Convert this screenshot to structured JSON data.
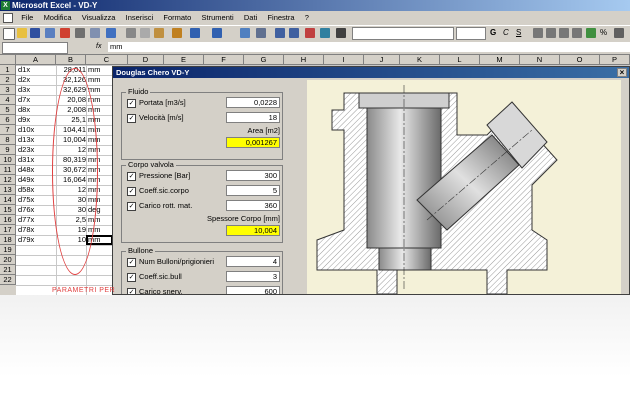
{
  "app": {
    "title": "Microsoft Excel - VD-Y",
    "icon": "excel-icon"
  },
  "menu": [
    "File",
    "Modifica",
    "Visualizza",
    "Inserisci",
    "Formato",
    "Strumenti",
    "Dati",
    "Finestra",
    "?"
  ],
  "formula_bar": {
    "name_box": "",
    "fx": "fx",
    "value": "mm"
  },
  "columns": [
    "A",
    "B",
    "C",
    "D",
    "E",
    "F",
    "G",
    "H",
    "I",
    "J",
    "K",
    "L",
    "M",
    "N",
    "O",
    "P"
  ],
  "rows": [
    "1",
    "2",
    "3",
    "4",
    "5",
    "6",
    "7",
    "8",
    "9",
    "10",
    "11",
    "12",
    "13",
    "14",
    "15",
    "16",
    "17",
    "18",
    "19",
    "20",
    "21",
    "22"
  ],
  "cells": [
    {
      "a": "d1x",
      "b": "28,011",
      "c": "mm"
    },
    {
      "a": "d2x",
      "b": "32,126",
      "c": "mm"
    },
    {
      "a": "d3x",
      "b": "32,629",
      "c": "mm"
    },
    {
      "a": "d7x",
      "b": "20,08",
      "c": "mm"
    },
    {
      "a": "d8x",
      "b": "2,008",
      "c": "mm"
    },
    {
      "a": "d9x",
      "b": "25,1",
      "c": "mm"
    },
    {
      "a": "d10x",
      "b": "104,41",
      "c": "mm"
    },
    {
      "a": "d13x",
      "b": "10,004",
      "c": "mm"
    },
    {
      "a": "d23x",
      "b": "12",
      "c": "mm"
    },
    {
      "a": "d31x",
      "b": "80,319",
      "c": "mm"
    },
    {
      "a": "d48x",
      "b": "30,672",
      "c": "mm"
    },
    {
      "a": "d49x",
      "b": "16,064",
      "c": "mm"
    },
    {
      "a": "d58x",
      "b": "12",
      "c": "mm"
    },
    {
      "a": "d75x",
      "b": "30",
      "c": "mm"
    },
    {
      "a": "d76x",
      "b": "30",
      "c": "deg"
    },
    {
      "a": "d77x",
      "b": "2,5",
      "c": "mm"
    },
    {
      "a": "d78x",
      "b": "19",
      "c": "mm"
    },
    {
      "a": "d79x",
      "b": "10",
      "c": "mm"
    }
  ],
  "annotation": "PARAMETRI PER",
  "dialog": {
    "title": "Douglas Chero VD-Y",
    "close": "×",
    "fluido": {
      "caption": "Fluido",
      "portata_label": "Portata [m3/s]",
      "portata_value": "0,0228",
      "velocita_label": "Velocità [m/s]",
      "velocita_value": "18",
      "area_label": "Area [m2]",
      "area_value": "0,001267"
    },
    "corpo": {
      "caption": "Corpo valvola",
      "pressione_label": "Pressione [Bar]",
      "pressione_value": "300",
      "coeff_label": "Coeff.sic.corpo",
      "coeff_value": "5",
      "carico_label": "Carico rott. mat.",
      "carico_value": "360",
      "spessore_label": "Spessore Corpo [mm]",
      "spessore_value": "10,004"
    },
    "bullone": {
      "caption": "Bullone",
      "num_label": "Num Bulloni/prigionieri",
      "num_value": "4",
      "coeff_label": "Coeff.sic.bull",
      "coeff_value": "3",
      "carico_label": "Carico snerv.",
      "carico_value": "600"
    }
  },
  "colors": {
    "title_bar": "#0a246a",
    "dialog_bg": "#d4d0c8",
    "highlight": "#ffff00",
    "annotation": "#e04040"
  }
}
